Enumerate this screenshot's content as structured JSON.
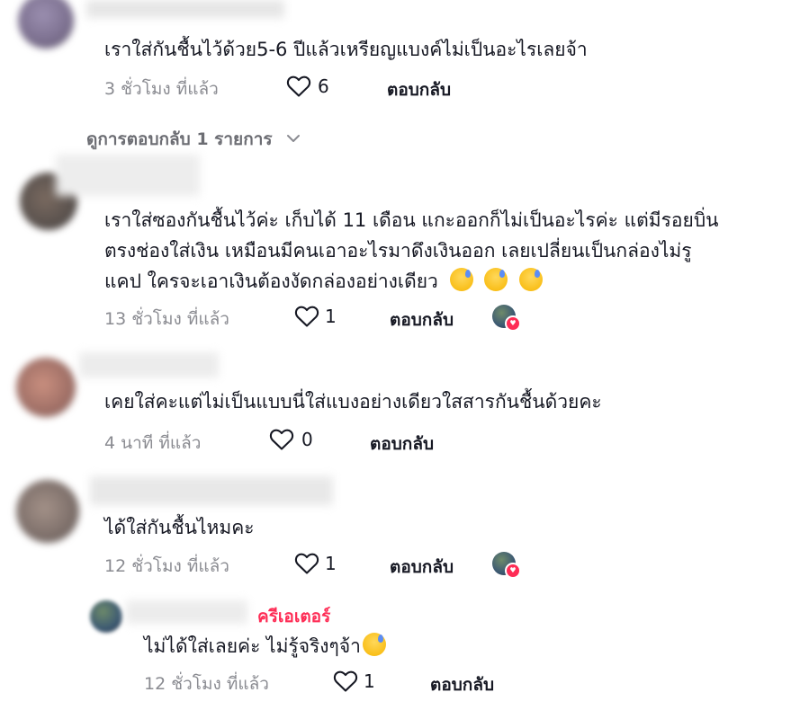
{
  "comments": [
    {
      "text_lines": [
        "เราใส่กันชื้นไว้ด้วย5-6 ปีแล้วเหรียญแบงค์ไม่เป็นอะไรเลยจ้า"
      ],
      "time": "3 ชั่วโมง ที่แล้ว",
      "likes": "6",
      "reply_label": "ตอบกลับ"
    },
    {
      "text_lines": [
        "เราใส่ซองกันชื้นไว้ค่ะ เก็บได้ 11 เดือน แกะออกก็ไม่เป็นอะไรค่ะ แต่มีรอยบิ่น",
        "ตรงช่องใส่เงิน เหมือนมีคนเอาอะไรมาดึงเงินออก เลยเปลี่ยนเป็นกล่องไม่รู",
        "แคป ใครจะเอาเงินต้องงัดกล่องอย่างเดียว"
      ],
      "time": "13 ชั่วโมง ที่แล้ว",
      "likes": "1",
      "reply_label": "ตอบกลับ"
    },
    {
      "text_lines": [
        "เคยใส่คะแต่ไม่เป็นแบบนี่ใส่แบงอย่างเดียวใสสารกันชื้นด้วยคะ"
      ],
      "time": "4 นาที ที่แล้ว",
      "likes": "0",
      "reply_label": "ตอบกลับ"
    },
    {
      "text_lines": [
        "ได้ใส่กันชื้นไหมคะ"
      ],
      "time": "12 ชั่วโมง ที่แล้ว",
      "likes": "1",
      "reply_label": "ตอบกลับ"
    }
  ],
  "view_replies": "ดูการตอบกลับ 1 รายการ",
  "creator_reply": {
    "tag": "ครีเอเตอร์",
    "text": "ไม่ได้ใส่เลยค่ะ ไม่รู้จริงๆจ้า",
    "time": "12 ชั่วโมง ที่แล้ว",
    "likes": "1",
    "reply_label": "ตอบกลับ"
  }
}
